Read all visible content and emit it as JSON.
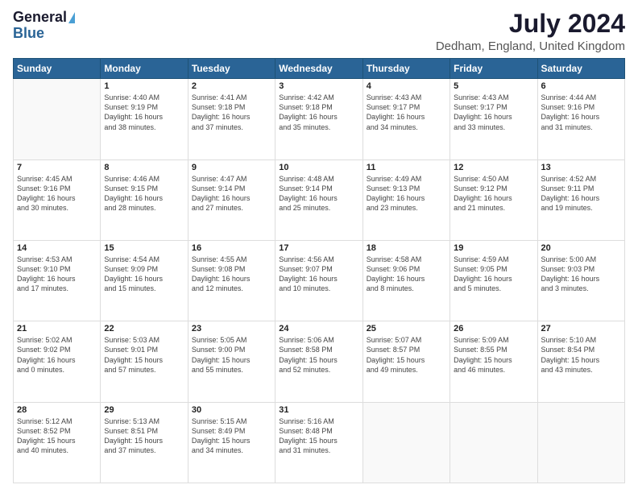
{
  "logo": {
    "general": "General",
    "blue": "Blue"
  },
  "title": "July 2024",
  "subtitle": "Dedham, England, United Kingdom",
  "weekdays": [
    "Sunday",
    "Monday",
    "Tuesday",
    "Wednesday",
    "Thursday",
    "Friday",
    "Saturday"
  ],
  "weeks": [
    [
      {
        "day": "",
        "info": ""
      },
      {
        "day": "1",
        "info": "Sunrise: 4:40 AM\nSunset: 9:19 PM\nDaylight: 16 hours\nand 38 minutes."
      },
      {
        "day": "2",
        "info": "Sunrise: 4:41 AM\nSunset: 9:18 PM\nDaylight: 16 hours\nand 37 minutes."
      },
      {
        "day": "3",
        "info": "Sunrise: 4:42 AM\nSunset: 9:18 PM\nDaylight: 16 hours\nand 35 minutes."
      },
      {
        "day": "4",
        "info": "Sunrise: 4:43 AM\nSunset: 9:17 PM\nDaylight: 16 hours\nand 34 minutes."
      },
      {
        "day": "5",
        "info": "Sunrise: 4:43 AM\nSunset: 9:17 PM\nDaylight: 16 hours\nand 33 minutes."
      },
      {
        "day": "6",
        "info": "Sunrise: 4:44 AM\nSunset: 9:16 PM\nDaylight: 16 hours\nand 31 minutes."
      }
    ],
    [
      {
        "day": "7",
        "info": "Sunrise: 4:45 AM\nSunset: 9:16 PM\nDaylight: 16 hours\nand 30 minutes."
      },
      {
        "day": "8",
        "info": "Sunrise: 4:46 AM\nSunset: 9:15 PM\nDaylight: 16 hours\nand 28 minutes."
      },
      {
        "day": "9",
        "info": "Sunrise: 4:47 AM\nSunset: 9:14 PM\nDaylight: 16 hours\nand 27 minutes."
      },
      {
        "day": "10",
        "info": "Sunrise: 4:48 AM\nSunset: 9:14 PM\nDaylight: 16 hours\nand 25 minutes."
      },
      {
        "day": "11",
        "info": "Sunrise: 4:49 AM\nSunset: 9:13 PM\nDaylight: 16 hours\nand 23 minutes."
      },
      {
        "day": "12",
        "info": "Sunrise: 4:50 AM\nSunset: 9:12 PM\nDaylight: 16 hours\nand 21 minutes."
      },
      {
        "day": "13",
        "info": "Sunrise: 4:52 AM\nSunset: 9:11 PM\nDaylight: 16 hours\nand 19 minutes."
      }
    ],
    [
      {
        "day": "14",
        "info": "Sunrise: 4:53 AM\nSunset: 9:10 PM\nDaylight: 16 hours\nand 17 minutes."
      },
      {
        "day": "15",
        "info": "Sunrise: 4:54 AM\nSunset: 9:09 PM\nDaylight: 16 hours\nand 15 minutes."
      },
      {
        "day": "16",
        "info": "Sunrise: 4:55 AM\nSunset: 9:08 PM\nDaylight: 16 hours\nand 12 minutes."
      },
      {
        "day": "17",
        "info": "Sunrise: 4:56 AM\nSunset: 9:07 PM\nDaylight: 16 hours\nand 10 minutes."
      },
      {
        "day": "18",
        "info": "Sunrise: 4:58 AM\nSunset: 9:06 PM\nDaylight: 16 hours\nand 8 minutes."
      },
      {
        "day": "19",
        "info": "Sunrise: 4:59 AM\nSunset: 9:05 PM\nDaylight: 16 hours\nand 5 minutes."
      },
      {
        "day": "20",
        "info": "Sunrise: 5:00 AM\nSunset: 9:03 PM\nDaylight: 16 hours\nand 3 minutes."
      }
    ],
    [
      {
        "day": "21",
        "info": "Sunrise: 5:02 AM\nSunset: 9:02 PM\nDaylight: 16 hours\nand 0 minutes."
      },
      {
        "day": "22",
        "info": "Sunrise: 5:03 AM\nSunset: 9:01 PM\nDaylight: 15 hours\nand 57 minutes."
      },
      {
        "day": "23",
        "info": "Sunrise: 5:05 AM\nSunset: 9:00 PM\nDaylight: 15 hours\nand 55 minutes."
      },
      {
        "day": "24",
        "info": "Sunrise: 5:06 AM\nSunset: 8:58 PM\nDaylight: 15 hours\nand 52 minutes."
      },
      {
        "day": "25",
        "info": "Sunrise: 5:07 AM\nSunset: 8:57 PM\nDaylight: 15 hours\nand 49 minutes."
      },
      {
        "day": "26",
        "info": "Sunrise: 5:09 AM\nSunset: 8:55 PM\nDaylight: 15 hours\nand 46 minutes."
      },
      {
        "day": "27",
        "info": "Sunrise: 5:10 AM\nSunset: 8:54 PM\nDaylight: 15 hours\nand 43 minutes."
      }
    ],
    [
      {
        "day": "28",
        "info": "Sunrise: 5:12 AM\nSunset: 8:52 PM\nDaylight: 15 hours\nand 40 minutes."
      },
      {
        "day": "29",
        "info": "Sunrise: 5:13 AM\nSunset: 8:51 PM\nDaylight: 15 hours\nand 37 minutes."
      },
      {
        "day": "30",
        "info": "Sunrise: 5:15 AM\nSunset: 8:49 PM\nDaylight: 15 hours\nand 34 minutes."
      },
      {
        "day": "31",
        "info": "Sunrise: 5:16 AM\nSunset: 8:48 PM\nDaylight: 15 hours\nand 31 minutes."
      },
      {
        "day": "",
        "info": ""
      },
      {
        "day": "",
        "info": ""
      },
      {
        "day": "",
        "info": ""
      }
    ]
  ]
}
